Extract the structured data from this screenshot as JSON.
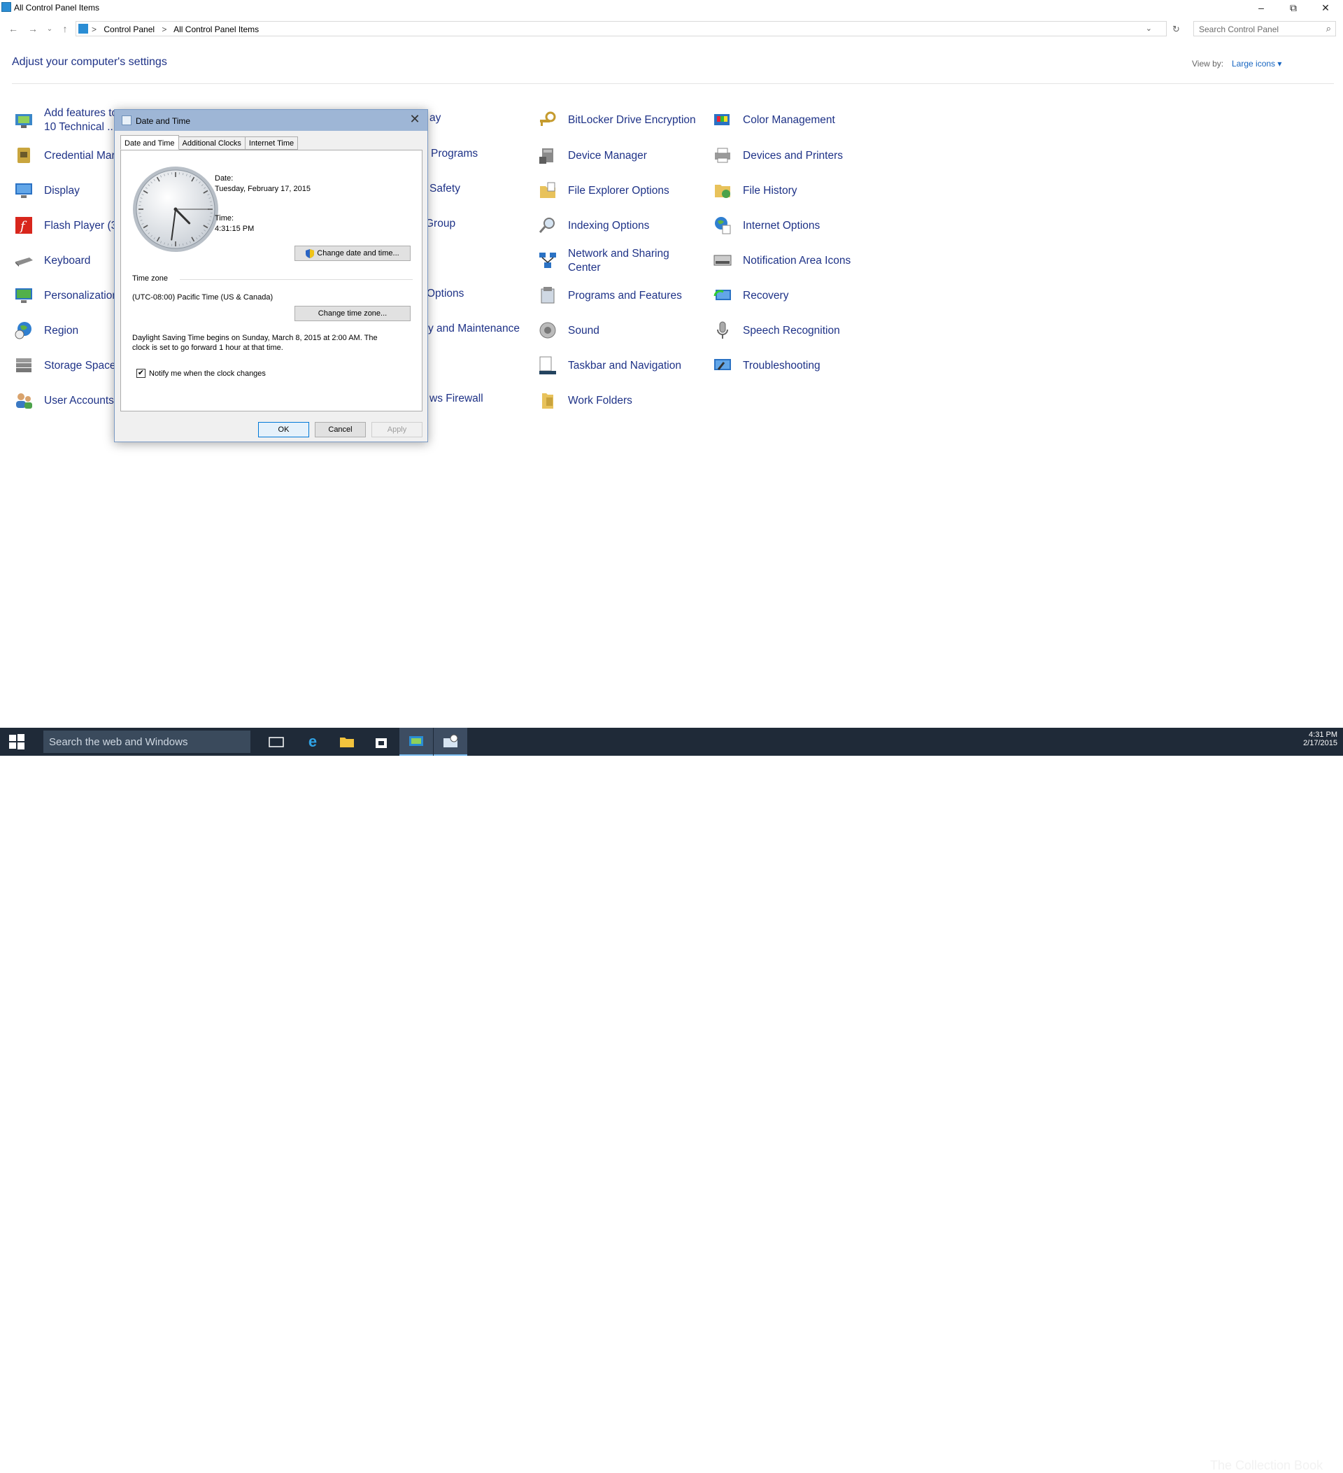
{
  "window": {
    "title": "All Control Panel Items",
    "minimize_icon": "minimize-icon",
    "restore_icon": "restore-icon",
    "close_icon": "close-icon"
  },
  "address": {
    "crumbs": [
      "Control Panel",
      "All Control Panel Items"
    ],
    "search_placeholder": "Search Control Panel"
  },
  "header": {
    "title": "Adjust your computer's settings",
    "view_by_label": "View by:",
    "view_by_value": "Large icons ▾"
  },
  "items": {
    "col1": [
      {
        "label": "Add features to",
        "label2": "10 Technical ...",
        "icon": "add-features-icon"
      },
      {
        "label": "Credential Mar",
        "icon": "credential-icon"
      },
      {
        "label": "Display",
        "icon": "display-icon"
      },
      {
        "label": "Flash Player (3",
        "icon": "flash-icon"
      },
      {
        "label": "Keyboard",
        "icon": "keyboard-icon"
      },
      {
        "label": "Personalization",
        "icon": "personalization-icon"
      },
      {
        "label": "Region",
        "icon": "region-icon"
      },
      {
        "label": "Storage Spaces",
        "icon": "storage-icon"
      },
      {
        "label": "User Accounts",
        "icon": "user-accounts-icon"
      }
    ],
    "col2": [
      {
        "label": "ay"
      },
      {
        "label": "Programs"
      },
      {
        "label": "Safety"
      },
      {
        "label": "Group"
      },
      {
        "label": ""
      },
      {
        "label": "Options"
      },
      {
        "label": "y and Maintenance"
      },
      {
        "label": ""
      },
      {
        "label": "ws Firewall"
      }
    ],
    "col3": [
      {
        "label": "BitLocker Drive Encryption",
        "icon": "bitlocker-icon"
      },
      {
        "label": "Device Manager",
        "icon": "device-manager-icon"
      },
      {
        "label": "File Explorer Options",
        "icon": "folder-options-icon"
      },
      {
        "label": "Indexing Options",
        "icon": "indexing-icon"
      },
      {
        "label": "Network and Sharing",
        "label2": "Center",
        "icon": "network-icon"
      },
      {
        "label": "Programs and Features",
        "icon": "programs-icon"
      },
      {
        "label": "Sound",
        "icon": "sound-icon"
      },
      {
        "label": "Taskbar and Navigation",
        "icon": "taskbar-icon"
      },
      {
        "label": "Work Folders",
        "icon": "work-folders-icon"
      }
    ],
    "col4": [
      {
        "label": "Color Management",
        "icon": "color-management-icon"
      },
      {
        "label": "Devices and Printers",
        "icon": "printer-icon"
      },
      {
        "label": "File History",
        "icon": "file-history-icon"
      },
      {
        "label": "Internet Options",
        "icon": "internet-options-icon"
      },
      {
        "label": "Notification Area Icons",
        "icon": "notification-icon"
      },
      {
        "label": "Recovery",
        "icon": "recovery-icon"
      },
      {
        "label": "Speech Recognition",
        "icon": "microphone-icon"
      },
      {
        "label": "Troubleshooting",
        "icon": "troubleshooting-icon"
      }
    ]
  },
  "dialog": {
    "title": "Date and Time",
    "tabs": [
      "Date and Time",
      "Additional Clocks",
      "Internet Time"
    ],
    "date_label": "Date:",
    "date_value": "Tuesday, February 17, 2015",
    "time_label": "Time:",
    "time_value": "4:31:15 PM",
    "change_datetime_button": "Change date and time...",
    "timezone_heading": "Time zone",
    "timezone_value": "(UTC-08:00) Pacific Time (US & Canada)",
    "change_timezone_button": "Change time zone...",
    "dst_line1": "Daylight Saving Time begins on Sunday, March 8, 2015 at 2:00 AM. The",
    "dst_line2": "clock is set to go forward 1 hour at that time.",
    "notify_label": "Notify me when the clock changes",
    "notify_checked": "✔",
    "ok": "OK",
    "cancel": "Cancel",
    "apply": "Apply",
    "clock": {
      "hours": 4,
      "minutes": 31,
      "seconds": 15
    }
  },
  "taskbar": {
    "search_placeholder": "Search the web and Windows",
    "time": "4:31 PM",
    "date": "2/17/2015",
    "watermark": "The Collection Book"
  }
}
